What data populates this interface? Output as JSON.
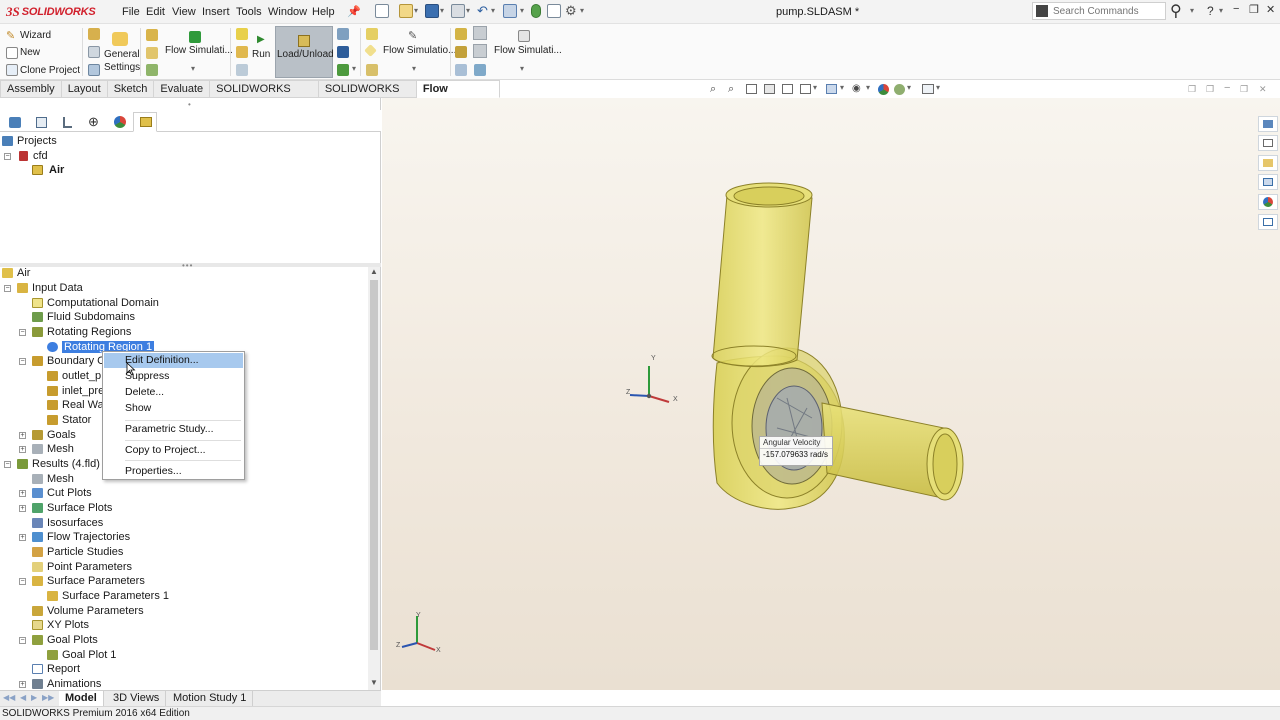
{
  "app": {
    "logo_ds": "3S",
    "logo_name": "SOLIDWORKS",
    "document_title": "pump.SLDASM *"
  },
  "menu": [
    "File",
    "Edit",
    "View",
    "Insert",
    "Tools",
    "Window",
    "Help"
  ],
  "search": {
    "placeholder": "Search Commands"
  },
  "ribbon": {
    "wizard": "Wizard",
    "new": "New",
    "clone_project": "Clone Project",
    "general_settings_1": "General",
    "general_settings_2": "Settings",
    "flow_sim_1": "Flow Simulati...",
    "run": "Run",
    "load_unload": "Load/Unload",
    "flow_sim_2": "Flow Simulatio...",
    "flow_sim_3": "Flow Simulati..."
  },
  "command_tabs": [
    "Assembly",
    "Layout",
    "Sketch",
    "Evaluate",
    "SOLIDWORKS Add-Ins",
    "SOLIDWORKS MBD",
    "Flow Simulation"
  ],
  "active_command_tab": "Flow Simulation",
  "project_tree": {
    "root": "Projects",
    "project": "cfd",
    "config": "Air"
  },
  "analysis_tree": {
    "root": "Air",
    "input_data": "Input Data",
    "computational_domain": "Computational Domain",
    "fluid_subdomains": "Fluid Subdomains",
    "rotating_regions": "Rotating Regions",
    "rotating_region_1": "Rotating Region 1",
    "boundary_conditions": "Boundary Co",
    "outlet": "outlet_p",
    "inlet": "inlet_pre",
    "real_wall": "Real Wa",
    "stator": "Stator",
    "goals": "Goals",
    "mesh_input": "Mesh",
    "results": "Results (4.fld)",
    "mesh": "Mesh",
    "cut_plots": "Cut Plots",
    "surface_plots": "Surface Plots",
    "isosurfaces": "Isosurfaces",
    "flow_trajectories": "Flow Trajectories",
    "particle_studies": "Particle Studies",
    "point_parameters": "Point Parameters",
    "surface_parameters": "Surface Parameters",
    "surface_parameters_1": "Surface Parameters 1",
    "volume_parameters": "Volume Parameters",
    "xy_plots": "XY Plots",
    "goal_plots": "Goal Plots",
    "goal_plot_1": "Goal Plot 1",
    "report": "Report",
    "animations": "Animations"
  },
  "context_menu": {
    "edit_definition": "Edit Definition...",
    "suppress": "Suppress",
    "delete": "Delete...",
    "show": "Show",
    "parametric_study": "Parametric Study...",
    "copy_to_project": "Copy to Project...",
    "properties": "Properties..."
  },
  "viewport": {
    "tooltip_title": "Angular Velocity",
    "tooltip_value": "-157.079633 rad/s",
    "axis_x": "X",
    "axis_y": "Y",
    "axis_z": "Z"
  },
  "bottom_tabs": [
    "Model",
    "3D Views",
    "Motion Study 1"
  ],
  "status_bar": "SOLIDWORKS Premium 2016 x64 Edition",
  "colors": {
    "accent_red": "#d11f2b",
    "selection_blue": "#3d7ee0",
    "menu_highlight": "#a7c9ee",
    "part_yellow": "#e8e07a"
  }
}
